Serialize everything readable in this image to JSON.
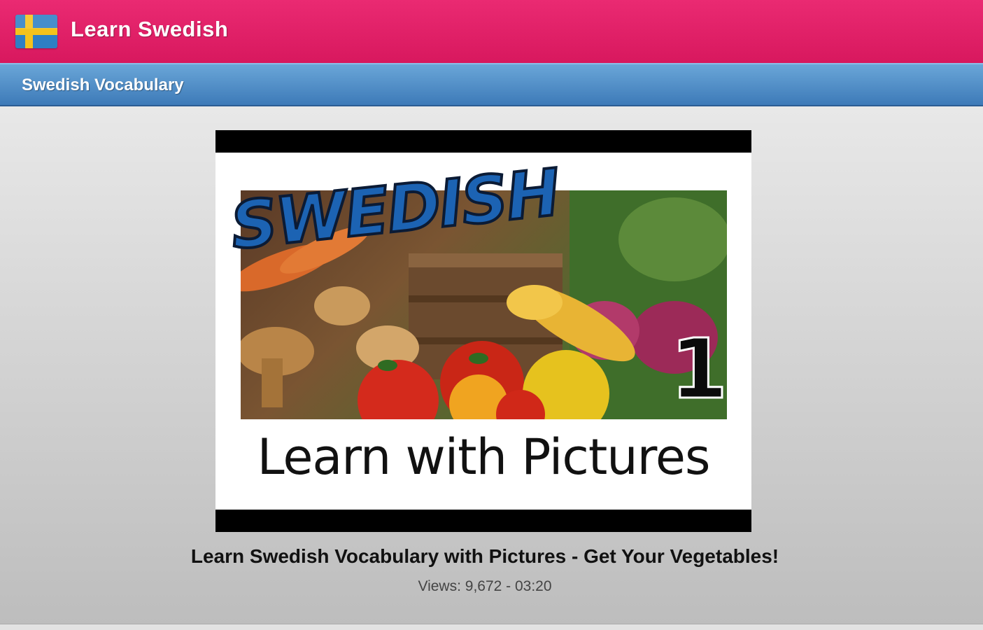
{
  "app_bar": {
    "title": "Learn Swedish",
    "flag_icon": "sweden-flag-icon",
    "background_color": "#e0206a"
  },
  "sub_bar": {
    "title": "Swedish Vocabulary",
    "background_color": "#4d8ac6"
  },
  "video": {
    "thumbnail": {
      "headline": "SWEDISH",
      "number": "1",
      "tagline": "Learn with Pictures"
    },
    "title": "Learn Swedish Vocabulary with Pictures - Get Your Vegetables!",
    "meta": "Views: 9,672 - 03:20"
  }
}
